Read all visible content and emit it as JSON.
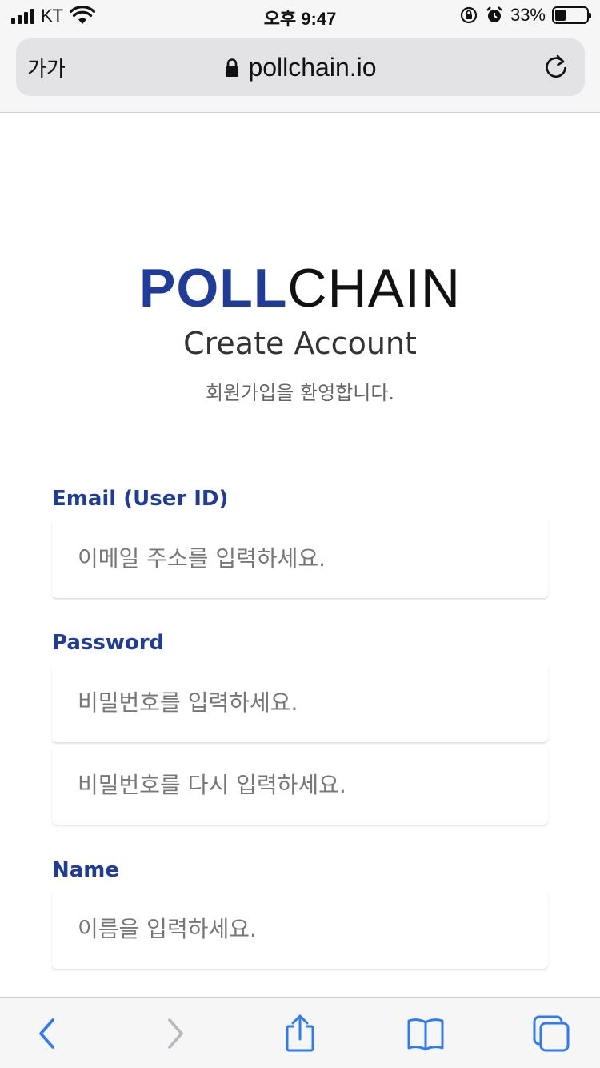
{
  "status_bar": {
    "carrier": "KT",
    "time": "오후 9:47",
    "battery_percent": "33%",
    "battery_level": 0.33
  },
  "browser": {
    "text_size_button": "가가",
    "url": "pollchain.io",
    "icons": [
      "signal-icon",
      "wifi-icon",
      "orientation-lock-icon",
      "alarm-icon",
      "battery-icon",
      "lock-icon",
      "reload-icon",
      "back-icon",
      "forward-icon",
      "share-icon",
      "bookmarks-icon",
      "tabs-icon"
    ]
  },
  "page": {
    "logo_part1": "POLL",
    "logo_part2": "CHAIN",
    "title": "Create Account",
    "subtitle": "회원가입을 환영합니다.",
    "email_label": "Email (User ID)",
    "email_placeholder": "이메일 주소를 입력하세요.",
    "password_label": "Password",
    "password_placeholder": "비밀번호를 입력하세요.",
    "password_confirm_placeholder": "비밀번호를 다시 입력하세요.",
    "name_label": "Name",
    "name_placeholder": "이름을 입력하세요."
  },
  "colors": {
    "brand_blue": "#1f3c98",
    "ios_blue": "#2f7bf6"
  }
}
